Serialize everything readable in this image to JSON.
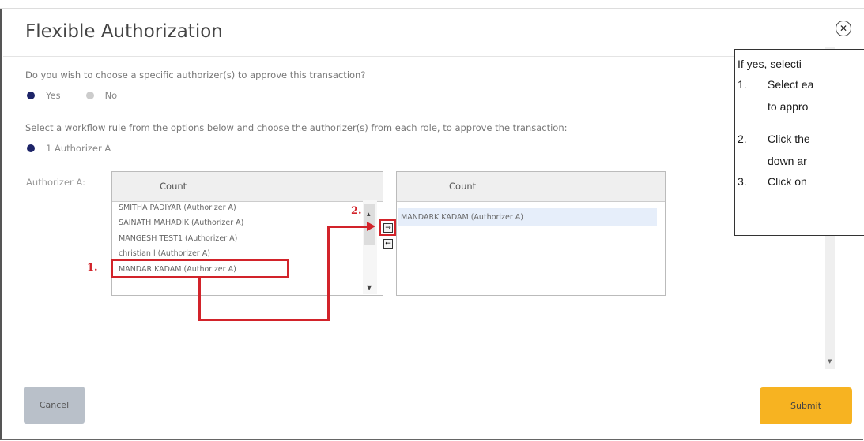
{
  "dialog": {
    "title": "Flexible Authorization",
    "close_icon": "close-circle-icon"
  },
  "question1": {
    "text": "Do you wish to choose a specific authorizer(s) to approve this transaction?",
    "options": [
      {
        "label": "Yes",
        "selected": true
      },
      {
        "label": "No",
        "selected": false
      }
    ]
  },
  "question2": {
    "text": "Select a workflow rule from the options below and choose the authorizer(s) from each role, to approve the transaction:",
    "rule": {
      "label": "1 Authorizer A",
      "selected": true
    }
  },
  "authorizer": {
    "label": "Authorizer A:",
    "available": {
      "header": "Count",
      "items": [
        "SMITHA PADIYAR (Authorizer A)",
        "SAINATH MAHADIK (Authorizer A)",
        "MANGESH TEST1 (Authorizer A)",
        "christian l (Authorizer A)",
        "MANDAR KADAM (Authorizer A)"
      ]
    },
    "selected": {
      "header": "Count",
      "items": [
        "MANDARK KADAM (Authorizer A)"
      ]
    },
    "move_right_icon": "arrow-right-icon",
    "move_left_icon": "arrow-left-icon"
  },
  "annotations": {
    "step1": "1.",
    "step2": "2.",
    "color": "#d2232a"
  },
  "callout": {
    "line1": "If yes, selecti",
    "line2_num": "1.",
    "line2": "Select ea",
    "line3": "to appro",
    "line4_num": "2.",
    "line4": "Click the",
    "line5": "down ar",
    "line6_num": "3.",
    "line6": "Click on"
  },
  "footer": {
    "cancel_label": "Cancel",
    "submit_label": "Submit",
    "submit_color": "#f7b321"
  }
}
